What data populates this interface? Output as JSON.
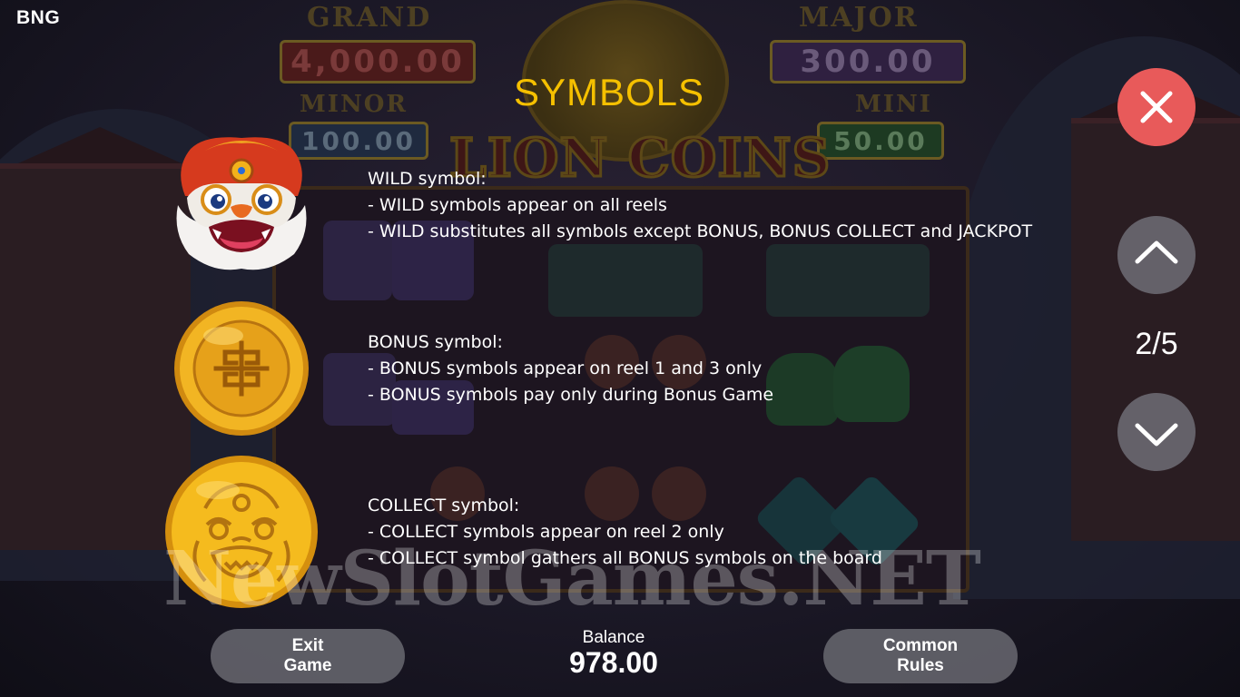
{
  "brand": "BNG",
  "background": {
    "jackpots": {
      "grand": {
        "label": "GRAND",
        "value": "4,000.00",
        "color": "#7a1f1f"
      },
      "major": {
        "label": "MAJOR",
        "value": "300.00",
        "color": "#4a2a6a"
      },
      "minor": {
        "label": "MINOR",
        "value": "100.00",
        "color": "#1f3f6a"
      },
      "mini": {
        "label": "MINI",
        "value": "50.00",
        "color": "#1f5a2a"
      }
    },
    "game_title": "LION COINS"
  },
  "heading": "SYMBOLS",
  "symbols": [
    {
      "icon": "lion-head-icon",
      "title": "WILD symbol:",
      "lines": [
        "- WILD symbols appear on all reels",
        "- WILD substitutes all symbols except BONUS, BONUS COLLECT and JACKPOT"
      ]
    },
    {
      "icon": "gold-coin-icon",
      "title": "BONUS symbol:",
      "lines": [
        "- BONUS symbols appear on reel 1 and 3 only",
        "- BONUS symbols pay only during Bonus Game"
      ]
    },
    {
      "icon": "lion-coin-icon",
      "title": "COLLECT symbol:",
      "lines": [
        "- COLLECT symbols appear on reel 2 only",
        "- COLLECT symbol gathers all BONUS symbols on the board"
      ]
    }
  ],
  "controls": {
    "close_icon": "close-icon",
    "up_icon": "chevron-up-icon",
    "down_icon": "chevron-down-icon",
    "page": "2/5",
    "close_color": "#e85a5a"
  },
  "footer": {
    "exit": {
      "line1": "Exit",
      "line2": "Game"
    },
    "balance_label": "Balance",
    "balance_value": "978.00",
    "rules": {
      "line1": "Common",
      "line2": "Rules"
    }
  },
  "watermark": "NewSlotGames.NET",
  "colors": {
    "heading": "#f5c000",
    "button_bg": "#76767e"
  }
}
